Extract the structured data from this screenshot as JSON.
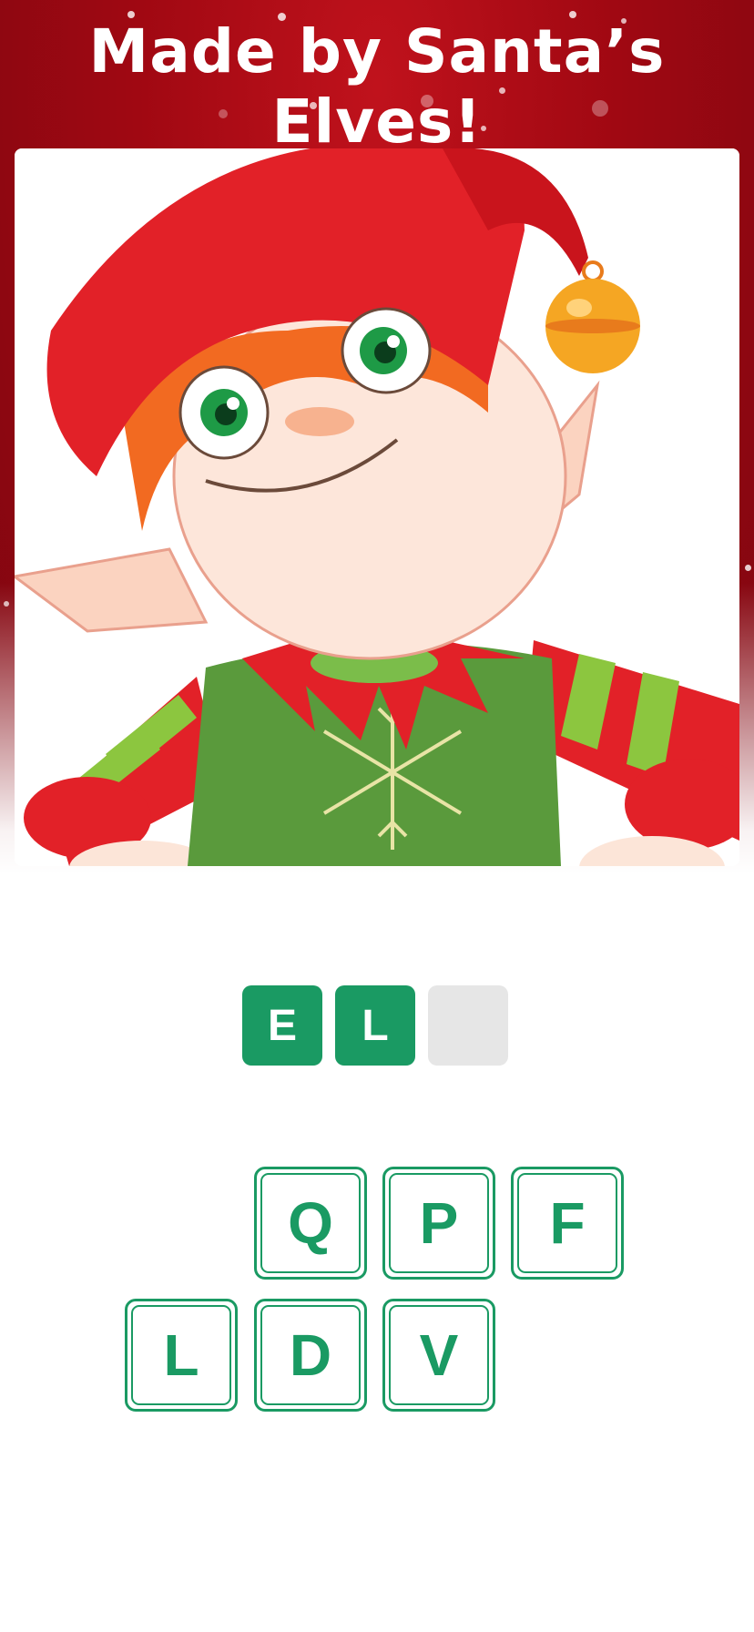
{
  "banner": {
    "title": "Made by Santa’s Elves!",
    "background_color": "#a00812"
  },
  "puzzle_image": {
    "subject": "cartoon Christmas elf with red hat, jingle bell and green striped sweater",
    "icon": "elf-illustration"
  },
  "answer": {
    "slots": [
      {
        "letter": "E",
        "state": "filled"
      },
      {
        "letter": "L",
        "state": "filled"
      },
      {
        "letter": "",
        "state": "empty"
      }
    ],
    "filled_color": "#1a9a63",
    "empty_color": "#e6e6e6"
  },
  "keyboard": {
    "row1": [
      "Q",
      "P",
      "F"
    ],
    "row2": [
      "L",
      "D",
      "V"
    ],
    "accent_color": "#1a9a63"
  }
}
